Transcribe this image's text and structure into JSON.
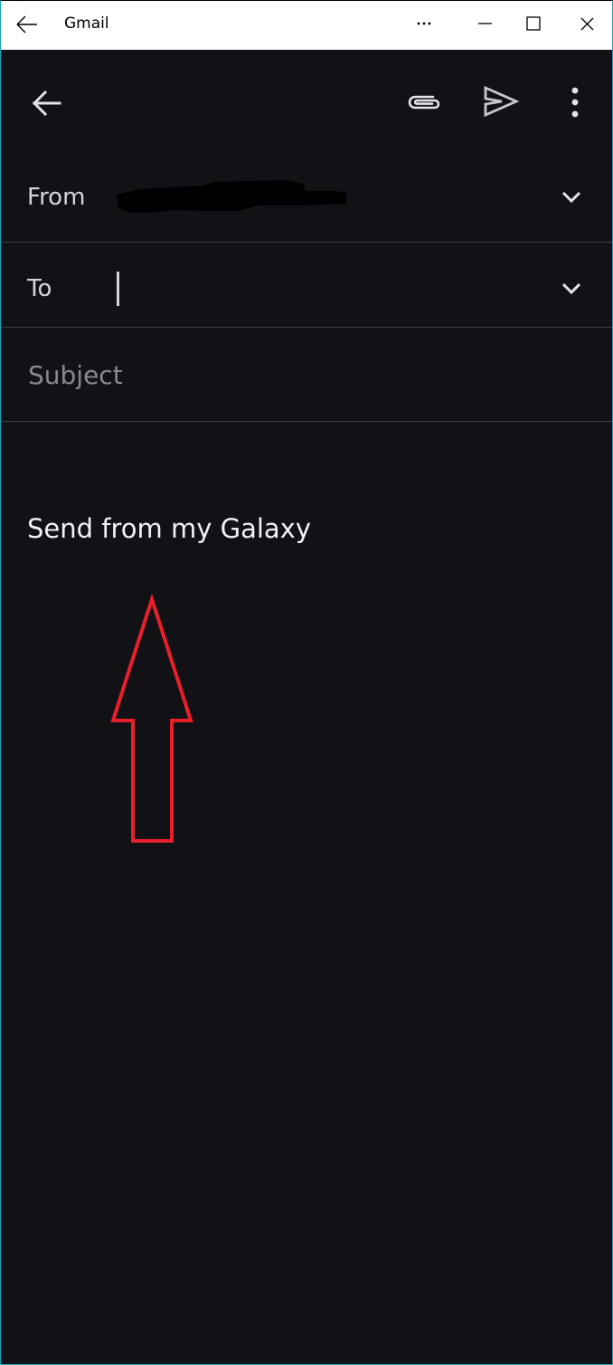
{
  "window": {
    "title": "Gmail",
    "titlebar_buttons": [
      "more-options",
      "minimize",
      "maximize",
      "close"
    ],
    "border_color": "#1aa6b5"
  },
  "toolbar": {
    "icons": {
      "back": "arrow-back-icon",
      "attach": "paperclip-icon",
      "send": "send-icon",
      "more": "more-vert-icon"
    }
  },
  "compose": {
    "from_label": "From",
    "from_value_redacted": true,
    "to_label": "To",
    "to_value": "",
    "subject_placeholder": "Subject",
    "subject_value": "",
    "body_signature": "Send from my Galaxy"
  },
  "annotation": {
    "type": "arrow-up",
    "color": "#e8202a",
    "points_to": "body_signature"
  },
  "colors": {
    "background": "#121116",
    "label_text": "#d6d5db",
    "placeholder_text": "#8a8990",
    "divider": "#3e3d44",
    "titlebar_bg": "#ffffff"
  }
}
